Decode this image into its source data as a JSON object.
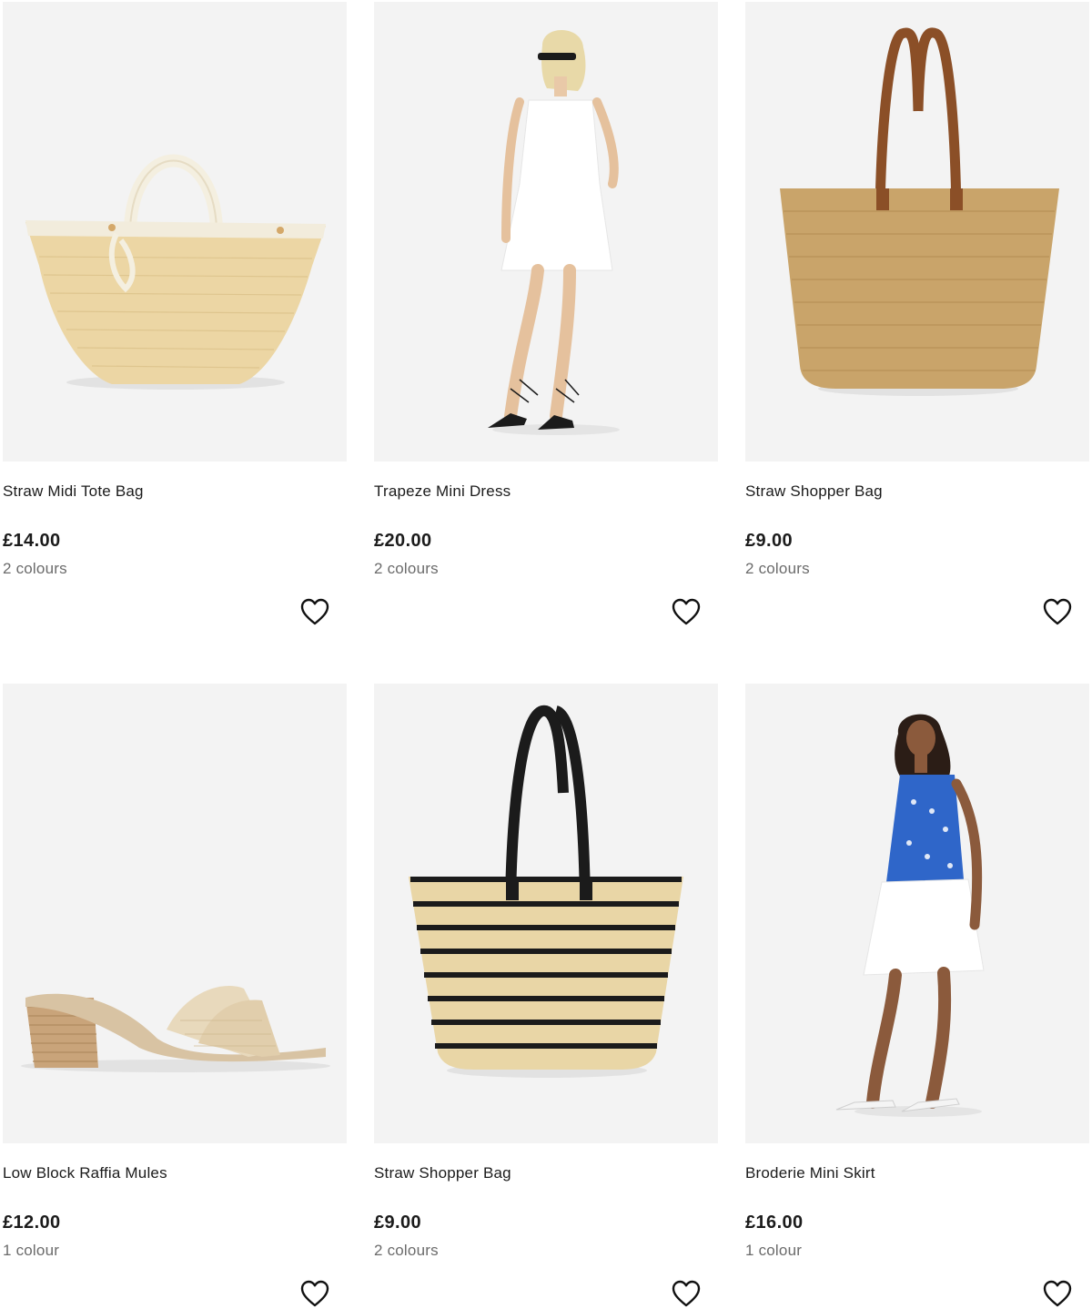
{
  "products": [
    {
      "name": "Straw Midi Tote Bag",
      "price": "£14.00",
      "colours": "2 colours",
      "image_icon": "straw-tote-bag-image"
    },
    {
      "name": "Trapeze Mini Dress",
      "price": "£20.00",
      "colours": "2 colours",
      "image_icon": "white-dress-model-image"
    },
    {
      "name": "Straw Shopper Bag",
      "price": "£9.00",
      "colours": "2 colours",
      "image_icon": "straw-shopper-bag-image"
    },
    {
      "name": "Low Block Raffia Mules",
      "price": "£12.00",
      "colours": "1 colour",
      "image_icon": "raffia-mule-shoe-image"
    },
    {
      "name": "Straw Shopper Bag",
      "price": "£9.00",
      "colours": "2 colours",
      "image_icon": "striped-shopper-bag-image"
    },
    {
      "name": "Broderie Mini Skirt",
      "price": "£16.00",
      "colours": "1 colour",
      "image_icon": "white-skirt-model-image"
    }
  ],
  "favourite_icon": "heart-outline-icon",
  "colors": {
    "image_bg": "#f3f3f3",
    "text": "#1b1b1b",
    "muted": "#6b6b6b"
  }
}
